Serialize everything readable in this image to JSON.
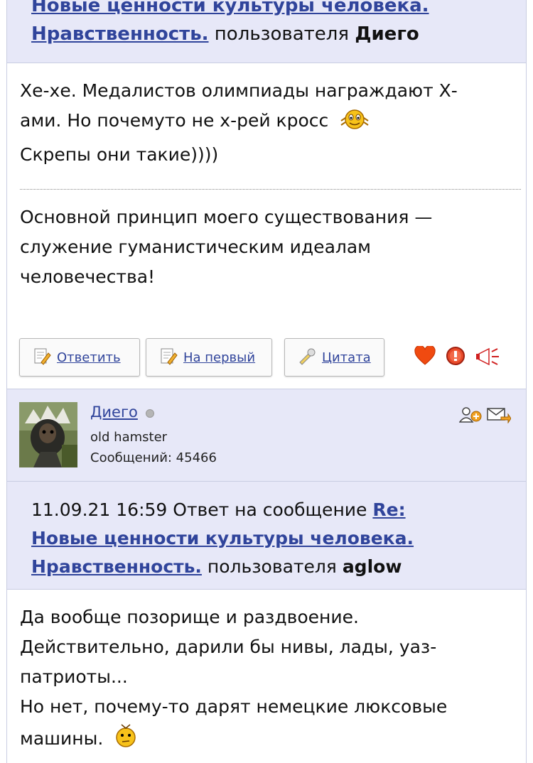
{
  "top_header": {
    "subject_line1": "Новые ценности культуры человека.",
    "subject_line2": "Нравственность.",
    "by_label": "пользователя",
    "author": "Диего"
  },
  "post1": {
    "line1": "Хе-хе. Медалистов олимпиады награждают Х-",
    "line2": "ами. Но почемуто не х-рей кросс",
    "line3": "Скрепы они такие))))",
    "smiley": "laughing-smiley-icon"
  },
  "signature": {
    "line1": "Основной принцип моего существования —",
    "line2": "служение гуманистическим идеалам",
    "line3": "человечества!"
  },
  "buttons": {
    "reply": "Ответить",
    "to_first": "На первый",
    "quote": "Цитата"
  },
  "action_icons": [
    "heart-icon",
    "report-icon",
    "megaphone-icon"
  ],
  "user": {
    "name": "Диего",
    "title": "old hamster",
    "messages": "Сообщений: 45466",
    "status": "offline",
    "icons": [
      "add-friend-icon",
      "send-message-icon"
    ]
  },
  "reply_header": {
    "datetime": "11.09.21 16:59",
    "reply_text": "Ответ на сообщение",
    "subject_prefix": "Re:",
    "subject_line1": "Новые ценности культуры человека.",
    "subject_line2": "Нравственность.",
    "by_label": "пользователя",
    "author": "aglow"
  },
  "post2": {
    "line1": "Да вообще позорище и раздвоение.",
    "line2": "Действительно, дарили бы нивы, лады, уаз-",
    "line3": "патриоты...",
    "line4": "Но нет, почему-то дарят немецкие люксовые",
    "line5": "машины.",
    "smiley": "thinking-smiley-icon"
  },
  "colors": {
    "header_bg": "#e7e8f8",
    "link": "#30449b",
    "border": "#c9cde2"
  }
}
